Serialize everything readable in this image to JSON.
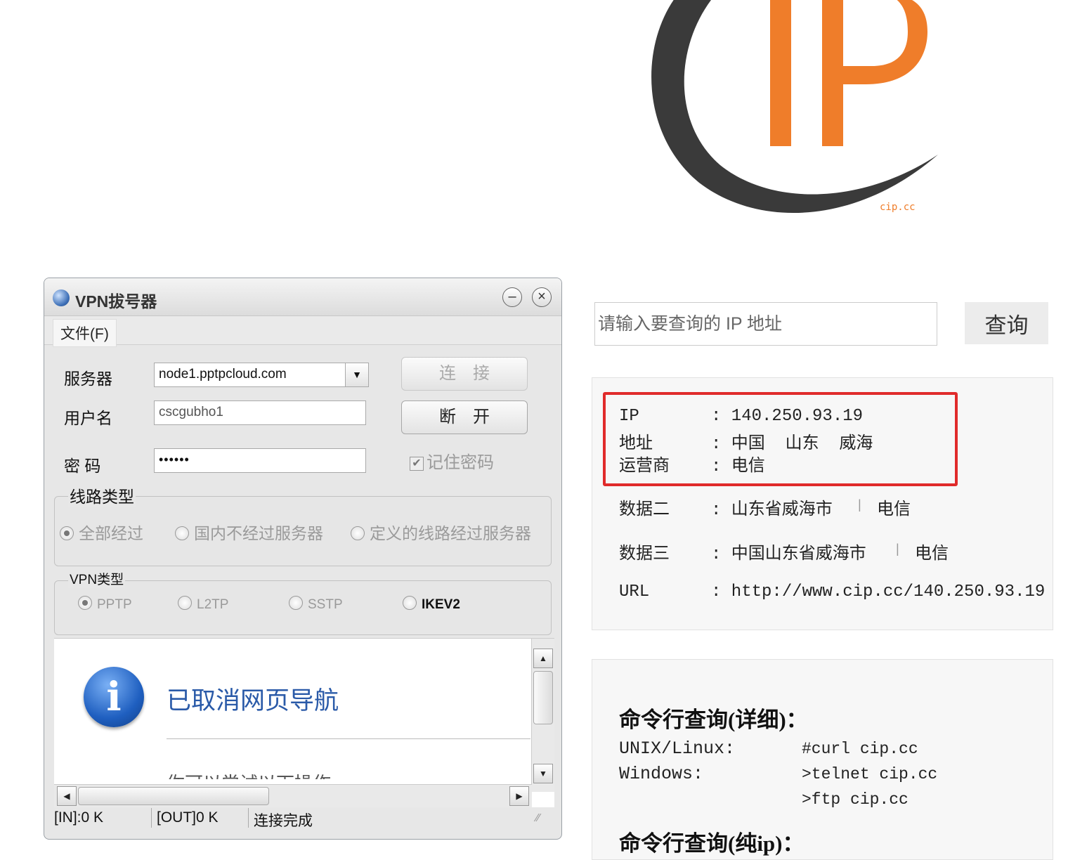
{
  "logo": {
    "letters": "IP",
    "site": "cip.cc",
    "colors": {
      "orange": "#ef7d2a",
      "ring": "#3a3a3a"
    }
  },
  "vpn_window": {
    "title": "VPN拔号器",
    "menu": {
      "file": "文件(F)"
    },
    "labels": {
      "server": "服务器",
      "username": "用户名",
      "password": "密 码"
    },
    "server_value": "node1.pptpcloud.com",
    "username_value": "cscgubho1",
    "password_mask": "••••••",
    "connect_label": "连接",
    "disconnect_label": "断开",
    "remember_label": "记住密码",
    "remember_checked": true,
    "route_group": {
      "title": "线路类型",
      "options": [
        "全部经过",
        "国内不经过服务器",
        "定义的线路经过服务器"
      ],
      "selected": 0
    },
    "vpn_type_group": {
      "title": "VPN类型",
      "options": [
        "PPTP",
        "L2TP",
        "SSTP",
        "IKEV2"
      ],
      "selected": 0
    },
    "browser": {
      "heading": "已取消网页导航",
      "partial_text": "你可以尝试以下操作",
      "info_icon_glyph": "i"
    },
    "status": {
      "in": "[IN]:0 K",
      "out": "[OUT]0 K",
      "state": "连接完成"
    }
  },
  "lookup": {
    "placeholder": "请输入要查询的 IP 地址",
    "button": "查询"
  },
  "result": {
    "ip_key": "IP",
    "ip_val": ": 140.250.93.19",
    "addr_key": "地址",
    "addr_val": ": 中国  山东  威海",
    "isp_key": "运营商",
    "isp_val": ": 电信",
    "d2_key": "数据二",
    "d2_val": ": 山东省威海市",
    "d2_isp": "电信",
    "d3_key": "数据三",
    "d3_val": ": 中国山东省威海市",
    "d3_isp": "电信",
    "url_key": "URL",
    "url_val": ": http://www.cip.cc/140.250.93.19",
    "pipe": "|",
    "highlight_color": "#e02b2b"
  },
  "cmd": {
    "detail_heading": "命令行查询(详细)：",
    "unix_label": "UNIX/Linux:",
    "unix_cmd": "#curl cip.cc",
    "win_label": "Windows:",
    "win_cmd1": ">telnet cip.cc",
    "win_cmd2": ">ftp cip.cc",
    "pure_heading": "命令行查询(纯ip)："
  }
}
